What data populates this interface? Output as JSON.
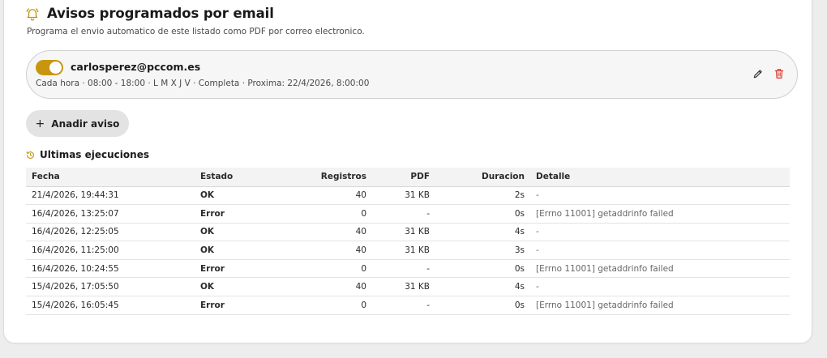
{
  "header": {
    "title": "Avisos programados por email",
    "subtitle": "Programa el envio automatico de este listado como PDF por correo electronico."
  },
  "schedule": {
    "enabled": true,
    "email": "carlosperez@pccom.es",
    "meta": "Cada hora · 08:00 - 18:00 · L M X J V · Completa · Proxima: 22/4/2026, 8:00:00"
  },
  "add_button": {
    "plus": "+",
    "label": "Anadir aviso"
  },
  "runs": {
    "title": "Ultimas ejecuciones",
    "columns": {
      "fecha": "Fecha",
      "estado": "Estado",
      "registros": "Registros",
      "pdf": "PDF",
      "duracion": "Duracion",
      "detalle": "Detalle"
    },
    "rows": [
      {
        "fecha": "21/4/2026, 19:44:31",
        "estado": "OK",
        "registros": "40",
        "pdf": "31 KB",
        "duracion": "2s",
        "detalle": "-"
      },
      {
        "fecha": "16/4/2026, 13:25:07",
        "estado": "Error",
        "registros": "0",
        "pdf": "-",
        "duracion": "0s",
        "detalle": "[Errno 11001] getaddrinfo failed"
      },
      {
        "fecha": "16/4/2026, 12:25:05",
        "estado": "OK",
        "registros": "40",
        "pdf": "31 KB",
        "duracion": "4s",
        "detalle": "-"
      },
      {
        "fecha": "16/4/2026, 11:25:00",
        "estado": "OK",
        "registros": "40",
        "pdf": "31 KB",
        "duracion": "3s",
        "detalle": "-"
      },
      {
        "fecha": "16/4/2026, 10:24:55",
        "estado": "Error",
        "registros": "0",
        "pdf": "-",
        "duracion": "0s",
        "detalle": "[Errno 11001] getaddrinfo failed"
      },
      {
        "fecha": "15/4/2026, 17:05:50",
        "estado": "OK",
        "registros": "40",
        "pdf": "31 KB",
        "duracion": "4s",
        "detalle": "-"
      },
      {
        "fecha": "15/4/2026, 16:05:45",
        "estado": "Error",
        "registros": "0",
        "pdf": "-",
        "duracion": "0s",
        "detalle": "[Errno 11001] getaddrinfo failed"
      }
    ]
  },
  "colors": {
    "accent": "#c8950f",
    "ok": "#1f7a3a",
    "error": "#b3261e",
    "delete": "#d93a2f"
  },
  "icons": {
    "title": "bell-icon",
    "edit": "pencil-icon",
    "delete": "trash-icon",
    "history": "history-icon"
  }
}
